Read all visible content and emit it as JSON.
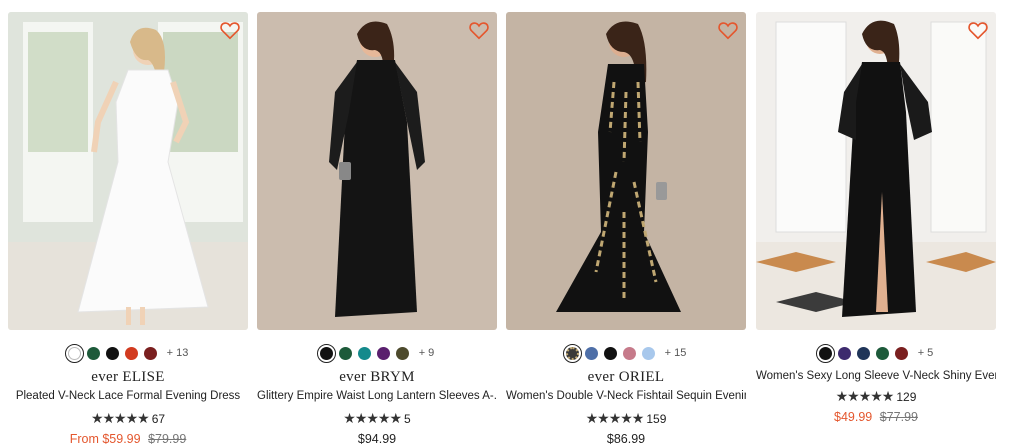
{
  "products": [
    {
      "brand": "ever ELISE",
      "title": "Pleated V-Neck Lace Formal Evening Dress",
      "stars": "★★★★★",
      "reviews": "67",
      "price_prefix": "From",
      "price": "$59.99",
      "original_price": "$79.99",
      "swatches": [
        "#ffffff",
        "#1d5a3a",
        "#111111",
        "#d23b1f",
        "#7a1f1f"
      ],
      "more": "+ 13"
    },
    {
      "brand": "ever BRYM",
      "title": "Glittery Empire Waist Long Lantern Sleeves A-...",
      "stars": "★★★★★",
      "reviews": "5",
      "price": "$94.99",
      "swatches": [
        "#111111",
        "#1d5a3a",
        "#148a8c",
        "#5a1f6e",
        "#4d4a2c"
      ],
      "more": "+ 9"
    },
    {
      "brand": "ever ORIEL",
      "title": "Women's Double V-Neck Fishtail Sequin Evenin...",
      "stars": "★★★★★",
      "reviews": "159",
      "price": "$86.99",
      "swatches": [
        "#3a3a3a",
        "#4e6fa8",
        "#111111",
        "#c67a8a",
        "#a8c8ec"
      ],
      "more": "+ 15"
    },
    {
      "title": "Women's Sexy Long Sleeve V-Neck Shiny Eveni...",
      "stars": "★★★★★",
      "reviews": "129",
      "price": "$49.99",
      "original_price": "$77.99",
      "swatches": [
        "#111111",
        "#3d2a6e",
        "#1f3559",
        "#1d5a3a",
        "#7a1f1f"
      ],
      "more": "+ 5"
    }
  ]
}
